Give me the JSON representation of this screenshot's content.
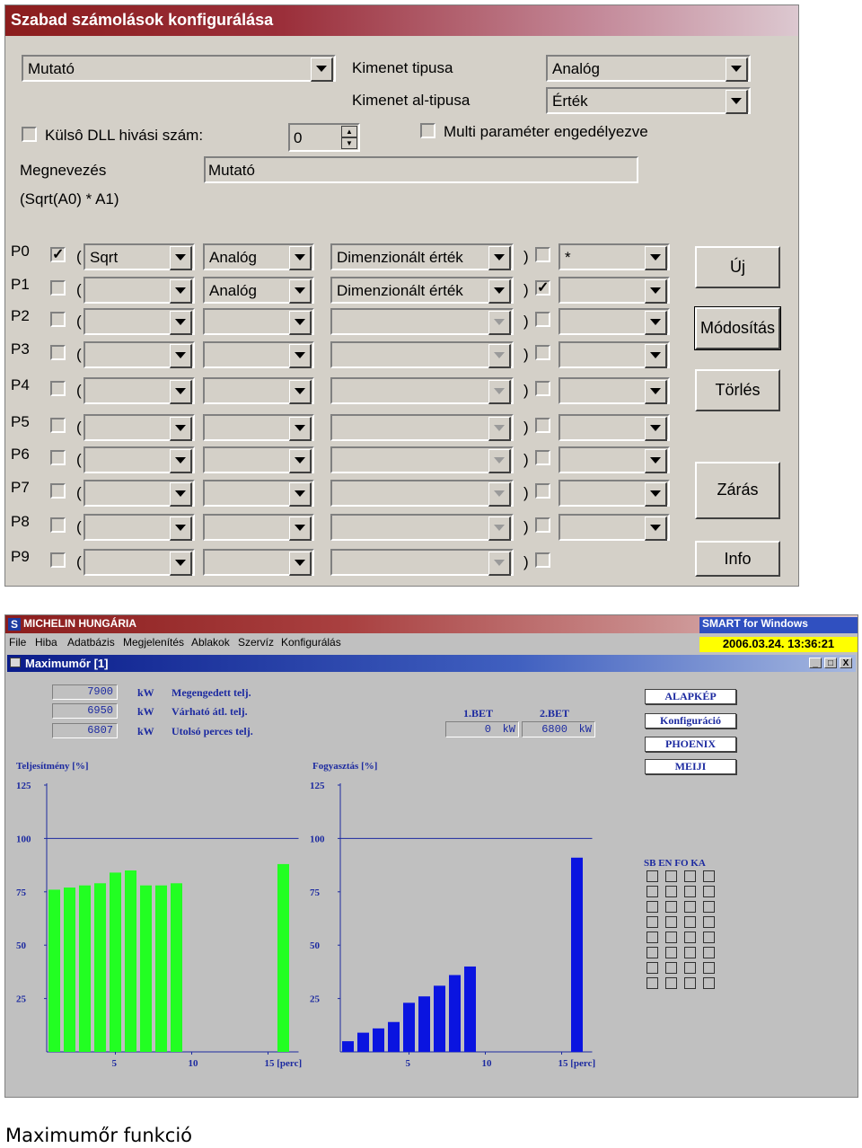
{
  "dialog": {
    "title": "Szabad számolások konfigurálása",
    "type_combo": "Mutató",
    "output_type_label": "Kimenet tipusa",
    "output_type_value": "Analóg",
    "output_subtype_label": "Kimenet al-tipusa",
    "output_subtype_value": "Érték",
    "dll_label": "Külsô DLL hivási szám:",
    "dll_value": "0",
    "multi_label": "Multi paraméter engedélyezve",
    "name_label": "Megnevezés",
    "name_value": "Mutató",
    "formula": "(Sqrt(A0) * A1)",
    "params": [
      {
        "label": "P0",
        "checked": true,
        "func": "Sqrt",
        "kind": "Analóg",
        "dim": "Dimenzionált érték",
        "checked2": false,
        "op": "*"
      },
      {
        "label": "P1",
        "checked": false,
        "func": "",
        "kind": "Analóg",
        "dim": "Dimenzionált érték",
        "checked2": true,
        "op": ""
      },
      {
        "label": "P2",
        "checked": false,
        "func": "",
        "kind": "",
        "dim": "",
        "checked2": false,
        "op": ""
      },
      {
        "label": "P3",
        "checked": false,
        "func": "",
        "kind": "",
        "dim": "",
        "checked2": false,
        "op": ""
      },
      {
        "label": "P4",
        "checked": false,
        "func": "",
        "kind": "",
        "dim": "",
        "checked2": false,
        "op": ""
      },
      {
        "label": "P5",
        "checked": false,
        "func": "",
        "kind": "",
        "dim": "",
        "checked2": false,
        "op": ""
      },
      {
        "label": "P6",
        "checked": false,
        "func": "",
        "kind": "",
        "dim": "",
        "checked2": false,
        "op": ""
      },
      {
        "label": "P7",
        "checked": false,
        "func": "",
        "kind": "",
        "dim": "",
        "checked2": false,
        "op": ""
      },
      {
        "label": "P8",
        "checked": false,
        "func": "",
        "kind": "",
        "dim": "",
        "checked2": false,
        "op": ""
      },
      {
        "label": "P9",
        "checked": false,
        "func": "",
        "kind": "",
        "dim": "",
        "checked2": false,
        "op": null
      }
    ],
    "open_paren": "(",
    "close_paren": ")",
    "buttons": {
      "new": "Új",
      "modify": "Módosítás",
      "delete": "Törlés",
      "close": "Zárás",
      "info": "Info"
    }
  },
  "app": {
    "title": "MICHELIN HUNGÁRIA",
    "logo_letter": "S",
    "menu": [
      "File",
      "Hiba",
      "Adatbázis",
      "Megjelenítés",
      "Ablakok",
      "Szervíz",
      "Konfigurálás"
    ],
    "product": "SMART for Windows",
    "datetime": "2006.03.24. 13:36:21",
    "window_title": "Maximumőr [1]",
    "window_buttons": [
      "_",
      "□",
      "X"
    ],
    "readings": [
      {
        "value": "7900",
        "unit": "kW",
        "label": "Megengedett telj."
      },
      {
        "value": "6950",
        "unit": "kW",
        "label": "Várható átl. telj."
      },
      {
        "value": "6807",
        "unit": "kW",
        "label": "Utolsó perces telj."
      }
    ],
    "bet1_label": "1.BET",
    "bet1_value": "0",
    "bet2_label": "2.BET",
    "bet2_value": "6800",
    "bet_unit": "kW",
    "side_buttons": [
      "ALAPKÉP",
      "Konfiguráció",
      "PHOENIX",
      "MEIJI"
    ],
    "status_header": "SB EN FO KA",
    "status_rows": 8,
    "status_cols": 4
  },
  "chart_data": [
    {
      "type": "bar",
      "title": "Teljesítmény [%]",
      "x": [
        1,
        2,
        3,
        4,
        5,
        6,
        7,
        8,
        9,
        16
      ],
      "values": [
        76,
        77,
        78,
        79,
        84,
        85,
        78,
        78,
        79,
        88
      ],
      "xticks": [
        "5",
        "10",
        "15 [perc]"
      ],
      "yticks": [
        "25",
        "50",
        "75",
        "100",
        "125"
      ],
      "ylim": [
        0,
        125
      ],
      "reference_line": 100,
      "color": "#22ff22"
    },
    {
      "type": "bar",
      "title": "Fogyasztás [%]",
      "x": [
        1,
        2,
        3,
        4,
        5,
        6,
        7,
        8,
        9,
        16
      ],
      "values": [
        5,
        9,
        11,
        14,
        23,
        26,
        31,
        36,
        40,
        91
      ],
      "xticks": [
        "5",
        "10",
        "15 [perc]"
      ],
      "yticks": [
        "25",
        "50",
        "75",
        "100",
        "125"
      ],
      "ylim": [
        0,
        125
      ],
      "reference_line": 100,
      "color": "#0a14e0"
    }
  ],
  "caption": "Maximumőr funkció"
}
